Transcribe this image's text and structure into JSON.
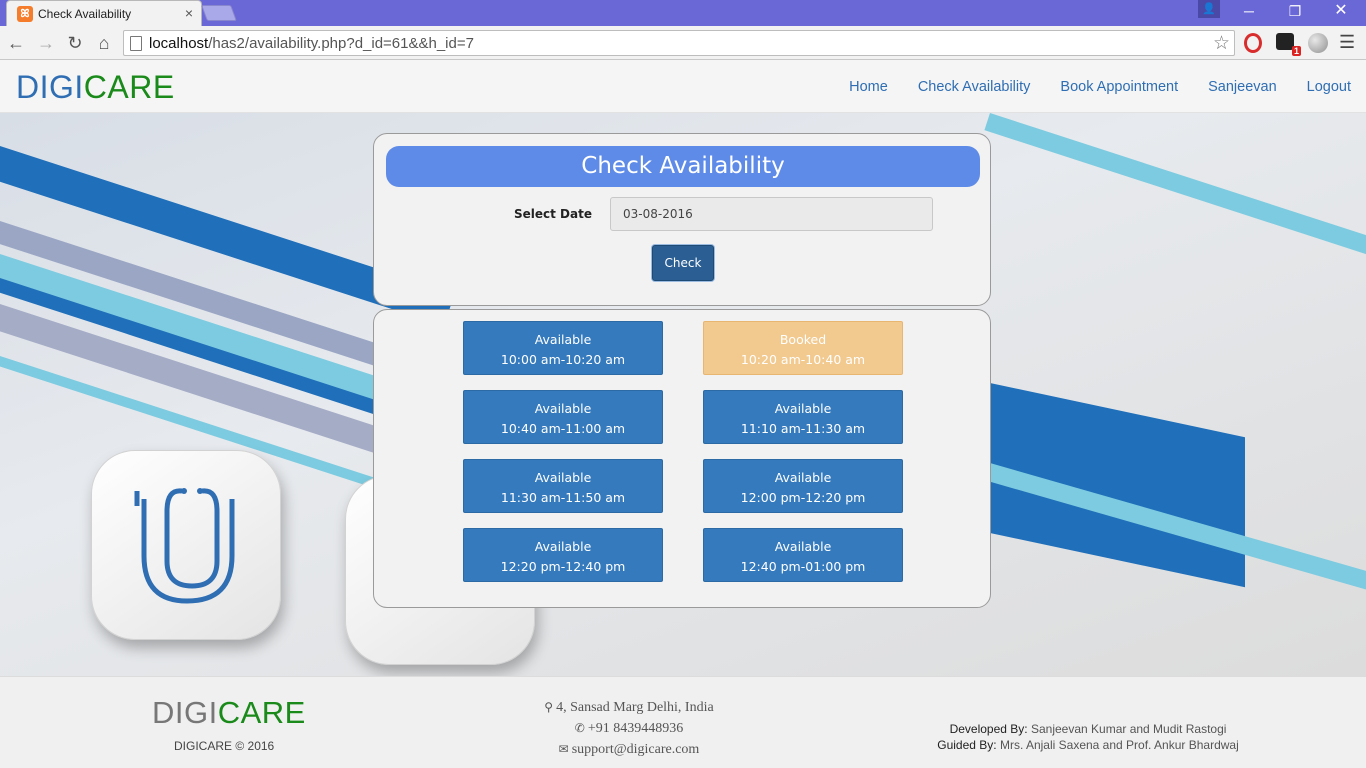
{
  "browser": {
    "tab_title": "Check Availability",
    "tab_close": "×",
    "url_host": "localhost",
    "url_path": "/has2/availability.php?d_id=61&&h_id=7",
    "badge_count": "1"
  },
  "site": {
    "brand_part1": "DIGI",
    "brand_part2": "CARE",
    "nav": {
      "home": "Home",
      "check": "Check Availability",
      "book": "Book Appointment",
      "user": "Sanjeevan",
      "logout": "Logout"
    }
  },
  "form": {
    "title": "Check Availability",
    "date_label": "Select Date",
    "date_value": "03-08-2016",
    "check_button": "Check"
  },
  "slots": [
    {
      "status": "Available",
      "time": "10:00 am-10:20 am"
    },
    {
      "status": "Booked",
      "time": "10:20 am-10:40 am"
    },
    {
      "status": "Available",
      "time": "10:40 am-11:00 am"
    },
    {
      "status": "Available",
      "time": "11:10 am-11:30 am"
    },
    {
      "status": "Available",
      "time": "11:30 am-11:50 am"
    },
    {
      "status": "Available",
      "time": "12:00 pm-12:20 pm"
    },
    {
      "status": "Available",
      "time": "12:20 pm-12:40 pm"
    },
    {
      "status": "Available",
      "time": "12:40 pm-01:00 pm"
    }
  ],
  "footer": {
    "brand_part1": "DIGI",
    "brand_part2": "CARE",
    "copyright": "DIGICARE © 2016",
    "address": "4, Sansad Marg Delhi, India",
    "phone": "+91 8439448936",
    "email": "support@digicare.com",
    "developed_label": "Developed By:",
    "developed_value": "Sanjeevan Kumar and Mudit Rastogi",
    "guided_label": "Guided By:",
    "guided_value": "Mrs. Anjali Saxena and Prof. Ankur Bhardwaj"
  },
  "colors": {
    "brand_blue": "#2f6eb3",
    "brand_green": "#1a8a1a",
    "slot_available": "#357abd",
    "slot_booked": "#f2c98e",
    "panel_title": "#5f8be8"
  }
}
